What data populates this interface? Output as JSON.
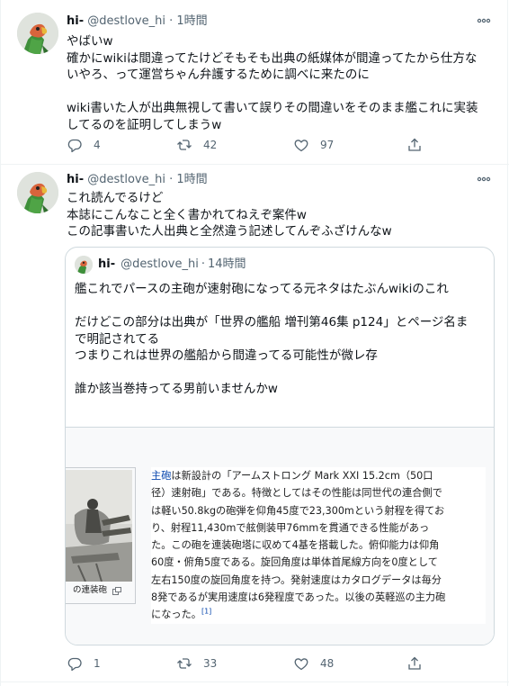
{
  "tweets": [
    {
      "author_name": "hi-",
      "handle": "@destlove_hi",
      "separator": "·",
      "time": "1時間",
      "more": "∘∘∘",
      "lines": [
        "やばいw",
        "確かにwikiは間違ってたけどそもそも出典の紙媒体が間違ってたから仕方な",
        "いやろ、って運営ちゃん弁護するために調べに来たのに",
        "",
        "wiki書いた人が出典無視して書いて誤りその間違いをそのまま艦これに実装",
        "してるのを証明してしまうw"
      ],
      "replies": "4",
      "retweets": "42",
      "likes": "97"
    },
    {
      "author_name": "hi-",
      "handle": "@destlove_hi",
      "separator": "·",
      "time": "1時間",
      "more": "∘∘∘",
      "lines": [
        "これ読んでるけど",
        "本誌にこんなこと全く書かれてねえぞ案件w",
        "この記事書いた人出典と全然違う記述してんぞふざけんなw"
      ],
      "replies": "1",
      "retweets": "33",
      "likes": "48"
    }
  ],
  "quote": {
    "author_name": "hi-",
    "handle": "@destlove_hi",
    "separator": "·",
    "time": "14時間",
    "lines": [
      "艦これでパースの主砲が速射砲になってる元ネタはたぶんwikiのこれ",
      "",
      "だけどこの部分は出典が「世界の艦船 増刊第46集 p124」とページ名ま",
      "で明記されてる",
      "つまりこれは世界の艦船から間違ってる可能性が微レ存",
      "",
      "誰か該当巻持ってる男前いませんかw"
    ],
    "wiki": {
      "caption": "の連装砲",
      "link_word": "主砲",
      "first_line_rest": "は新設計の「アームストロング Mark XXI 15.2cm（50口",
      "lines": [
        "径）速射砲」である。特徴としてはその性能は同世代の連合側で",
        "は軽い50.8kgの砲弾を仰角45度で23,300mという射程を得てお",
        "り、射程11,430mで舷側装甲76mmを貫通できる性能があっ",
        "た。この砲を連装砲塔に収めて4基を搭載した。俯仰能力は仰角",
        "60度・俯角5度である。旋回角度は単体首尾線方向を0度として",
        "左右150度の旋回角度を持つ。発射速度はカタログデータは毎分",
        "8発であるが実用速度は6発程度であった。以後の英軽巡の主力砲"
      ],
      "last_line": "になった。",
      "ref": "[1]"
    }
  },
  "colors": {
    "text": "#0f1419",
    "secondary": "#536471",
    "border": "#cfd9de",
    "wiki_link": "#0645ad"
  },
  "icons": {
    "reply": "reply-icon",
    "retweet": "retweet-icon",
    "like": "heart-icon",
    "share": "share-icon",
    "more": "more-icon"
  }
}
